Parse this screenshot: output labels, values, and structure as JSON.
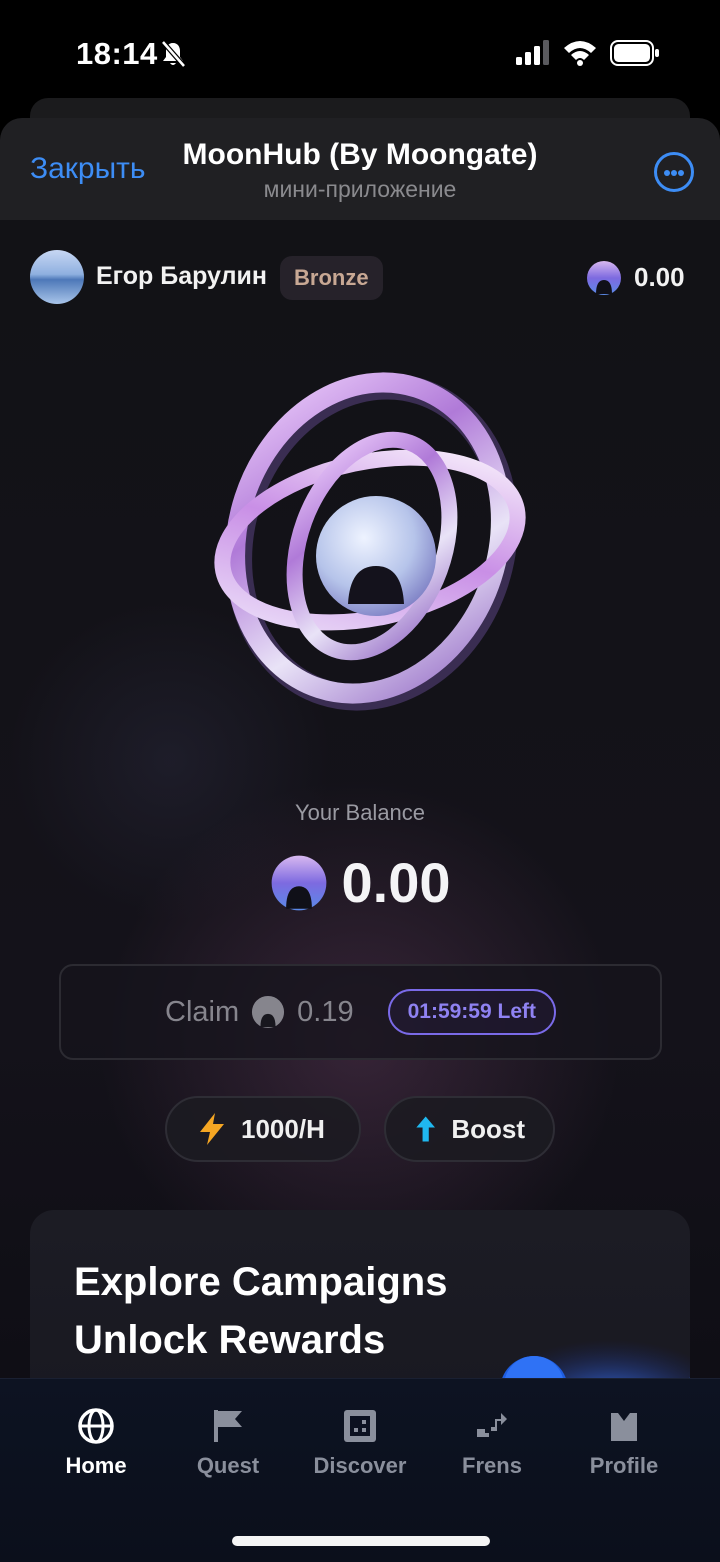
{
  "status_bar": {
    "time": "18:14"
  },
  "telegram_header": {
    "close_label": "Закрыть",
    "title": "MoonHub (By Moongate)",
    "subtitle": "мини-приложение"
  },
  "user": {
    "name": "Егор Барулин",
    "tier": "Bronze",
    "balance": "0.00"
  },
  "balance": {
    "label": "Your Balance",
    "value": "0.00"
  },
  "claim": {
    "label": "Claim",
    "amount": "0.19",
    "timer": "01:59:59 Left"
  },
  "actions": {
    "rate_label": "1000/H",
    "boost_label": "Boost"
  },
  "campaign": {
    "line1": "Explore Campaigns",
    "line2": "Unlock Rewards"
  },
  "nav": {
    "items": [
      {
        "label": "Home",
        "icon": "globe-icon",
        "active": true
      },
      {
        "label": "Quest",
        "icon": "flag-icon",
        "active": false
      },
      {
        "label": "Discover",
        "icon": "discover-icon",
        "active": false
      },
      {
        "label": "Frens",
        "icon": "frens-icon",
        "active": false
      },
      {
        "label": "Profile",
        "icon": "profile-icon",
        "active": false
      }
    ]
  },
  "colors": {
    "accent_blue": "#3d8df5",
    "timer_purple": "#8f82f2",
    "bolt_orange": "#f5a623",
    "boost_cyan": "#1fb8f0",
    "tier_text": "#c8a894"
  }
}
